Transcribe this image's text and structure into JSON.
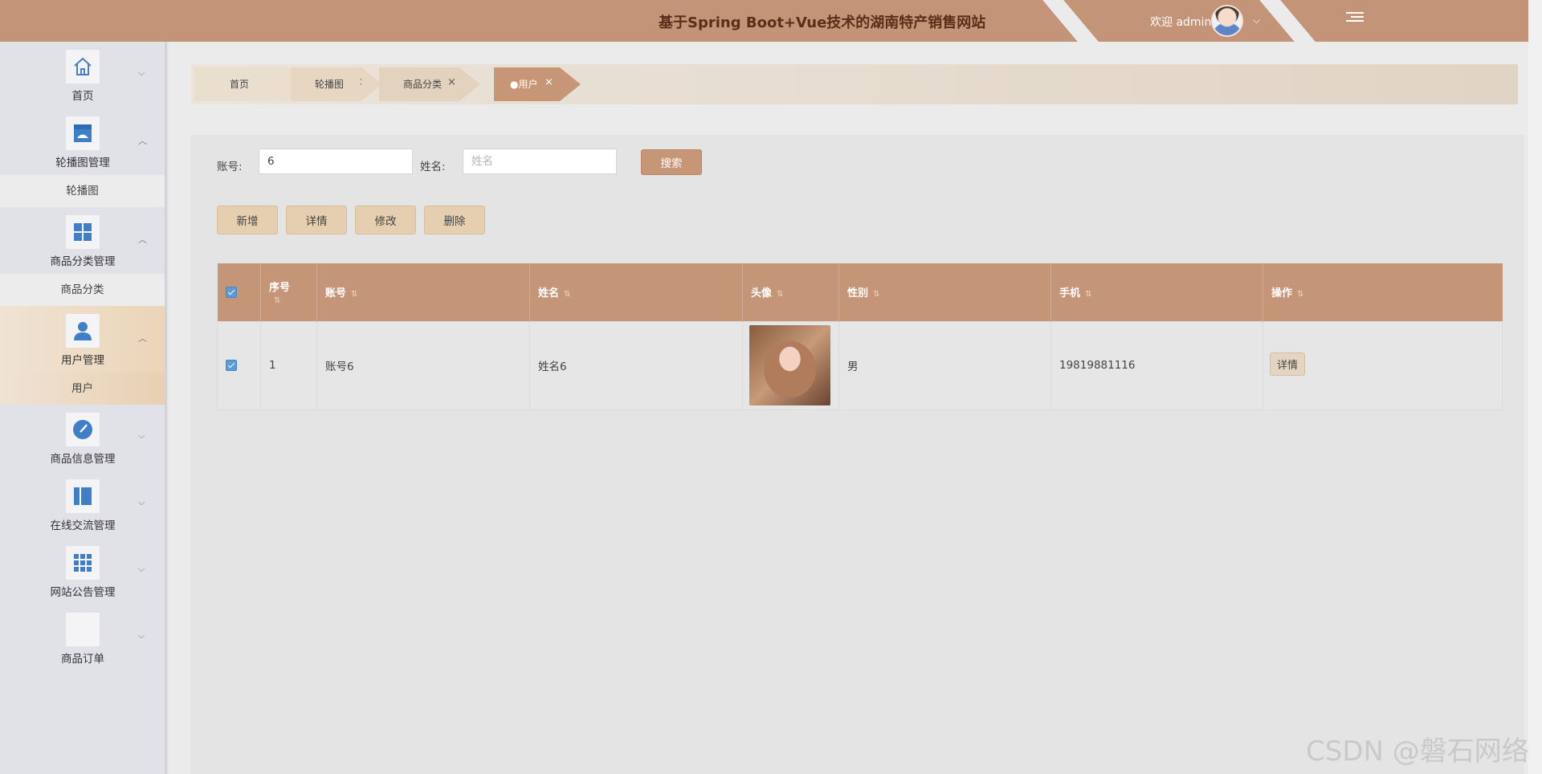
{
  "header": {
    "title": "基于Spring Boot+Vue技术的湖南特产销售网站",
    "welcome": "欢迎 admin"
  },
  "sidebar": {
    "menus": [
      {
        "label": "首页",
        "icon": "home-icon",
        "arrow": "⌄"
      },
      {
        "label": "轮播图管理",
        "icon": "shop-icon",
        "arrow": "⌃",
        "sub": "轮播图"
      },
      {
        "label": "商品分类管理",
        "icon": "grid-icon",
        "arrow": "⌃",
        "sub": "商品分类"
      },
      {
        "label": "用户管理",
        "icon": "user-icon",
        "arrow": "⌃",
        "sub": "用户"
      },
      {
        "label": "商品信息管理",
        "icon": "compass-icon",
        "arrow": "⌄"
      },
      {
        "label": "在线交流管理",
        "icon": "book-icon",
        "arrow": "⌄"
      },
      {
        "label": "网站公告管理",
        "icon": "apps-icon",
        "arrow": "⌄"
      },
      {
        "label": "商品订单",
        "icon": "blank-icon",
        "arrow": "⌄"
      }
    ]
  },
  "tabs": [
    {
      "label": "首页"
    },
    {
      "label": "轮播图"
    },
    {
      "label": "商品分类"
    },
    {
      "label": "●用户"
    }
  ],
  "search": {
    "account_label": "账号:",
    "account_value": "6",
    "name_label": "姓名:",
    "name_placeholder": "姓名",
    "search_button": "搜索"
  },
  "actions": {
    "add": "新增",
    "detail": "详情",
    "edit": "修改",
    "delete": "删除"
  },
  "table": {
    "headers": [
      "序号",
      "账号",
      "姓名",
      "头像",
      "性别",
      "手机",
      "操作"
    ],
    "rows": [
      {
        "index": "1",
        "account": "账号6",
        "name": "姓名6",
        "gender": "男",
        "phone": "19819881116",
        "op": "详情"
      }
    ]
  },
  "watermark": "CSDN @磐石网络",
  "colors": {
    "header": "#c49478",
    "table_header": "#c59577",
    "accent": "#c79677"
  }
}
